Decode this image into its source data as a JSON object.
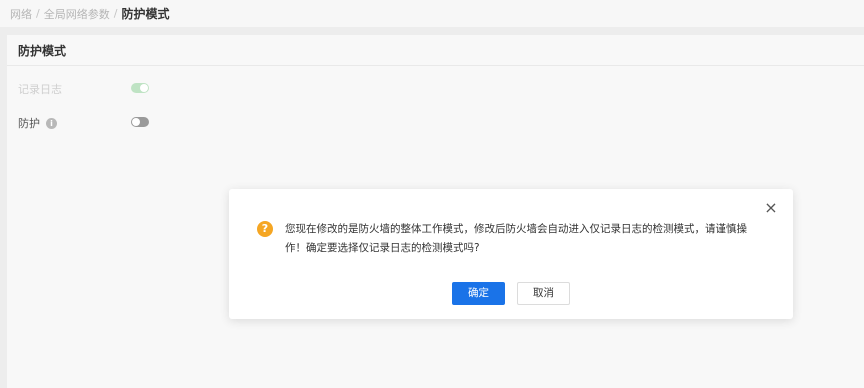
{
  "breadcrumb": {
    "items": [
      "网络",
      "全局网络参数"
    ],
    "separator": "/",
    "current": "防护模式"
  },
  "panel": {
    "title": "防护模式",
    "fields": {
      "log": {
        "label": "记录日志",
        "enabled": true,
        "disabled": true
      },
      "protect": {
        "label": "防护",
        "info_icon": "i",
        "enabled": false
      }
    }
  },
  "dialog": {
    "icon": "?",
    "close_icon": "×",
    "message": "您现在修改的是防火墙的整体工作模式，修改后防火墙会自动进入仅记录日志的检测模式，请谨慎操作！确定要选择仅记录日志的检测模式吗?",
    "ok_label": "确定",
    "cancel_label": "取消"
  },
  "colors": {
    "primary": "#1a73e8",
    "warning": "#f5a623",
    "switch_on_disabled": "#bfe3c4",
    "switch_off": "#9a9a9a"
  }
}
